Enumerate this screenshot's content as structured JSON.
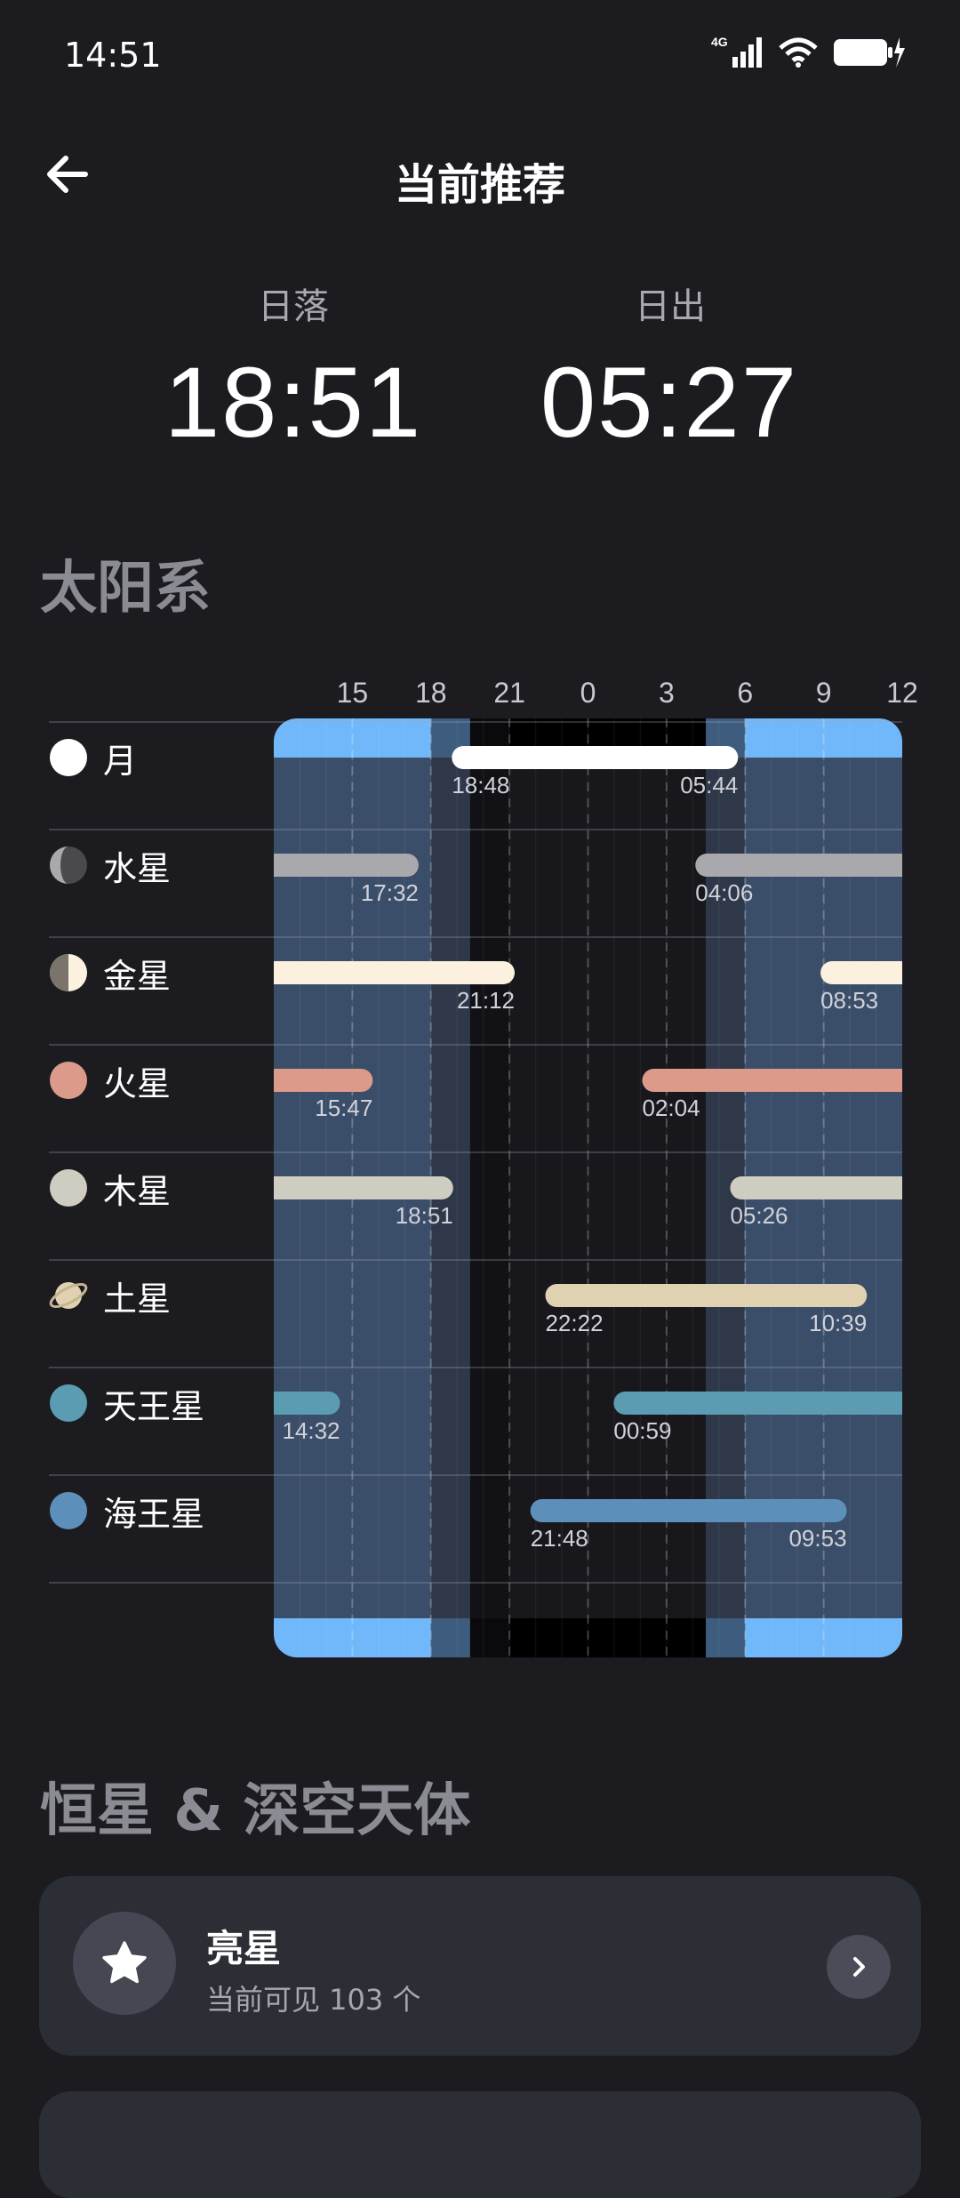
{
  "status": {
    "time": "14:51",
    "network": "4G"
  },
  "header": {
    "title": "当前推荐"
  },
  "sun": {
    "sunset_label": "日落",
    "sunset_time": "18:51",
    "sunrise_label": "日出",
    "sunrise_time": "05:27"
  },
  "sections": {
    "solar_system": "太阳系",
    "deep_sky": "恒星 & 深空天体"
  },
  "chart_data": {
    "type": "timeline",
    "x_ticks": [
      "15",
      "18",
      "21",
      "0",
      "3",
      "6",
      "9",
      "12"
    ],
    "x_range_hours": [
      12,
      36
    ],
    "twilight_bands": {
      "day_end": 18.0,
      "civil_end": 19.5,
      "night_start": 21.0,
      "night_end": 28.5,
      "civil_start": 30.0
    },
    "rows": [
      {
        "name": "月",
        "icon": "moon-icon",
        "color": "#ffffff",
        "segments": [
          [
            18.8,
            29.73
          ]
        ],
        "label_a": "18:48",
        "label_b": "05:44"
      },
      {
        "name": "水星",
        "icon": "mercury-icon",
        "color": "#a9a9ad",
        "segments": [
          [
            12,
            17.53
          ],
          [
            28.1,
            36
          ]
        ],
        "label_a": "17:32",
        "label_b": "04:06"
      },
      {
        "name": "金星",
        "icon": "venus-icon",
        "color": "#fbf1de",
        "segments": [
          [
            12,
            21.2
          ],
          [
            32.88,
            36
          ]
        ],
        "label_a": "21:12",
        "label_b": "08:53"
      },
      {
        "name": "火星",
        "icon": "mars-icon",
        "color": "#dc9a8a",
        "segments": [
          [
            12,
            15.78
          ],
          [
            26.07,
            36
          ]
        ],
        "label_a": "15:47",
        "label_b": "02:04"
      },
      {
        "name": "木星",
        "icon": "jupiter-icon",
        "color": "#cfcdc2",
        "segments": [
          [
            12,
            18.85
          ],
          [
            29.43,
            36
          ]
        ],
        "label_a": "18:51",
        "label_b": "05:26"
      },
      {
        "name": "土星",
        "icon": "saturn-icon",
        "color": "#e0d1b1",
        "segments": [
          [
            22.37,
            34.65
          ]
        ],
        "label_a": "22:22",
        "label_b": "10:39"
      },
      {
        "name": "天王星",
        "icon": "uranus-icon",
        "color": "#5b9cb2",
        "segments": [
          [
            12,
            14.53
          ],
          [
            24.98,
            36
          ]
        ],
        "label_a": "14:32",
        "label_b": "00:59"
      },
      {
        "name": "海王星",
        "icon": "neptune-icon",
        "color": "#5d8fbb",
        "segments": [
          [
            21.8,
            33.88
          ]
        ],
        "label_a": "21:48",
        "label_b": "09:53"
      }
    ]
  },
  "bright_stars": {
    "title": "亮星",
    "subtitle": "当前可见 103 个"
  },
  "colors": {
    "day": "#70b8fa",
    "day_overlay": "#3b4e69",
    "civil": "#3d5c7e",
    "civil_overlay": "#2f3849",
    "night": "#000000",
    "night_overlay": "#18181c"
  }
}
